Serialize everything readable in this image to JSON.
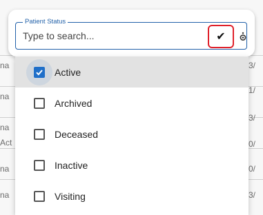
{
  "background": {
    "left_fragments": [
      "na",
      "na",
      "na",
      "Act",
      "na",
      "na"
    ],
    "right_fragments": [
      "3/",
      "1/",
      "3/",
      "0/",
      "0/",
      "3/"
    ],
    "top_fragments": [
      "",
      "",
      "",
      "",
      ""
    ]
  },
  "search": {
    "legend": "Patient Status",
    "placeholder": "Type to search...",
    "confirm_icon": "check-icon",
    "settings_icon": "gear-icon",
    "accent_color": "#1f5fa8",
    "highlight_color": "#e0202a"
  },
  "dropdown": {
    "options": [
      {
        "label": "Active",
        "checked": true
      },
      {
        "label": "Archived",
        "checked": false
      },
      {
        "label": "Deceased",
        "checked": false
      },
      {
        "label": "Inactive",
        "checked": false
      },
      {
        "label": "Visiting",
        "checked": false
      }
    ]
  }
}
